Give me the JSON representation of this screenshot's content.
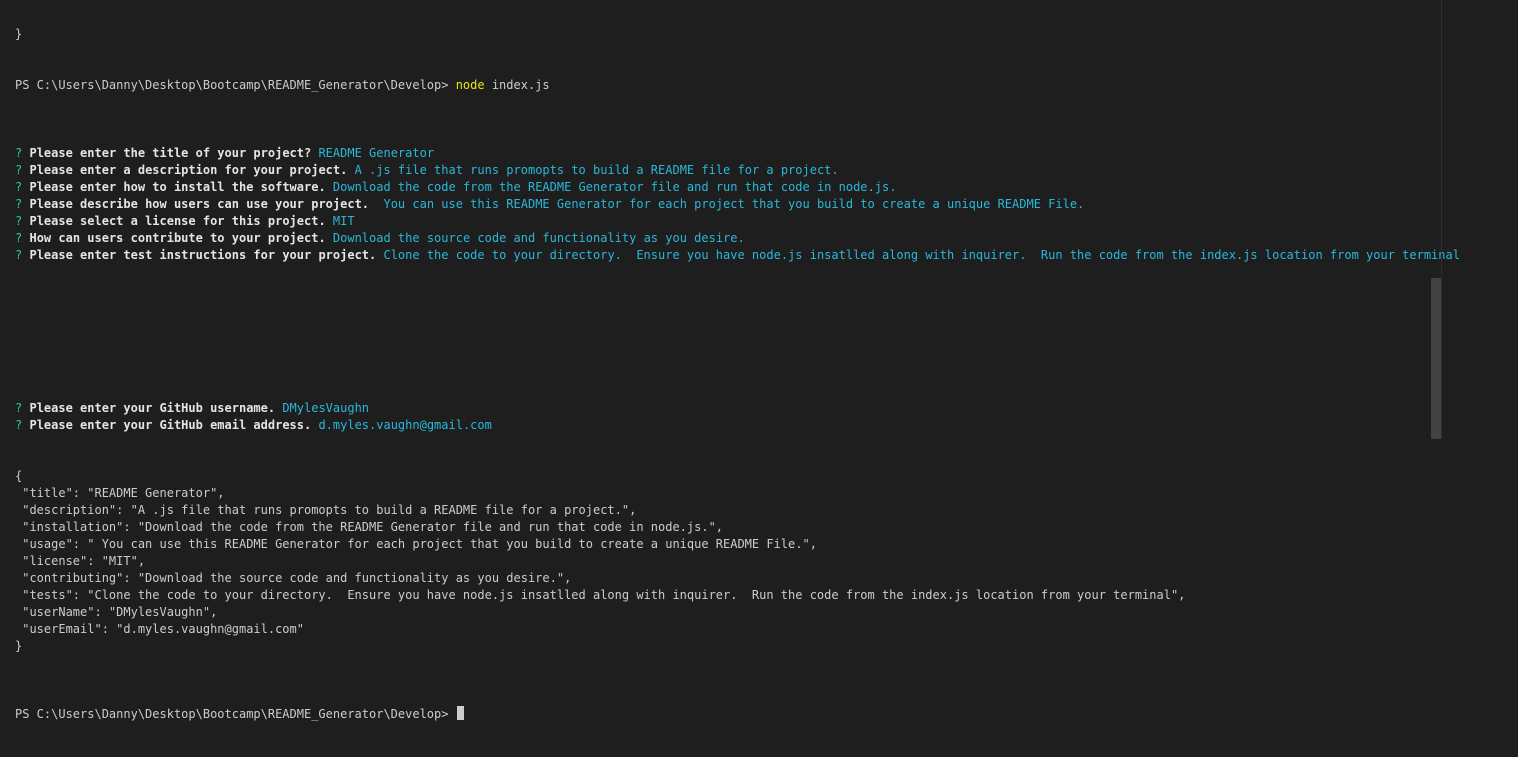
{
  "terminal": {
    "top_line": "}",
    "prompt": "PS C:\\Users\\Danny\\Desktop\\Bootcamp\\README_Generator\\Develop> ",
    "command_name": "node",
    "command_args": " index.js",
    "qa": [
      {
        "mark": "?",
        "question": "Please enter the title of your project?",
        "answer": " README Generator"
      },
      {
        "mark": "?",
        "question": "Please enter a description for your project.",
        "answer": " A .js file that runs promopts to build a README file for a project."
      },
      {
        "mark": "?",
        "question": "Please enter how to install the software.",
        "answer": " Download the code from the README Generator file and run that code in node.js."
      },
      {
        "mark": "?",
        "question": "Please describe how users can use your project.",
        "answer": "  You can use this README Generator for each project that you build to create a unique README File."
      },
      {
        "mark": "?",
        "question": "Please select a license for this project.",
        "answer": " MIT"
      },
      {
        "mark": "?",
        "question": "How can users contribute to your project.",
        "answer": " Download the source code and functionality as you desire."
      },
      {
        "mark": "?",
        "question": "Please enter test instructions for your project.",
        "answer": " Clone the code to your directory.  Ensure you have node.js insatlled along with inquirer.  Run the code from the index.js location from your terminal"
      }
    ],
    "qa2": [
      {
        "mark": "?",
        "question": "Please enter your GitHub username.",
        "answer": " DMylesVaughn"
      },
      {
        "mark": "?",
        "question": "Please enter your GitHub email address.",
        "answer": " d.myles.vaughn@gmail.com"
      }
    ],
    "json_lines": [
      "{",
      " \"title\": \"README Generator\",",
      " \"description\": \"A .js file that runs promopts to build a README file for a project.\",",
      " \"installation\": \"Download the code from the README Generator file and run that code in node.js.\",",
      " \"usage\": \" You can use this README Generator for each project that you build to create a unique README File.\",",
      " \"license\": \"MIT\",",
      " \"contributing\": \"Download the source code and functionality as you desire.\",",
      " \"tests\": \"Clone the code to your directory.  Ensure you have node.js insatlled along with inquirer.  Run the code from the index.js location from your terminal\",",
      " \"userName\": \"DMylesVaughn\",",
      " \"userEmail\": \"d.myles.vaughn@gmail.com\"",
      "}"
    ],
    "final_prompt": "PS C:\\Users\\Danny\\Desktop\\Bootcamp\\README_Generator\\Develop> "
  }
}
